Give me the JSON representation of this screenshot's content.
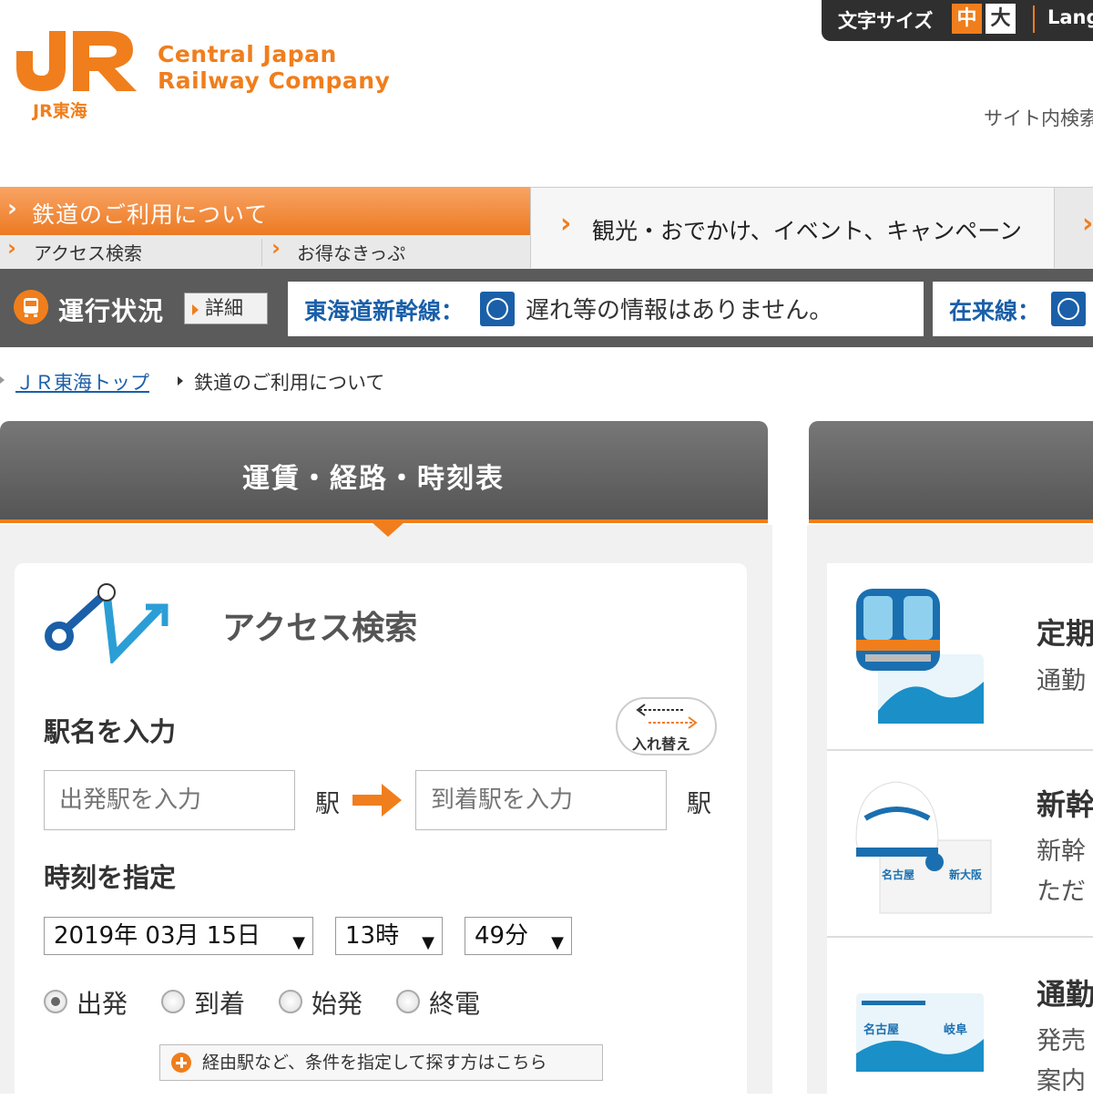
{
  "header": {
    "logo_text": "JR東海",
    "company_line1": "Central Japan",
    "company_line2": "Railway Company",
    "font_size_label": "文字サイズ",
    "font_size_medium": "中",
    "font_size_large": "大",
    "language_label": "Lang",
    "site_search_label": "サイト内検索"
  },
  "nav": {
    "main_item": "鉄道のご利用について",
    "sub_items": [
      "アクセス検索",
      "お得なきっぷ"
    ],
    "tourism_item": "観光・おでかけ、イベント、キャンペーン"
  },
  "status": {
    "title": "運行状況",
    "detail_button": "詳細",
    "shinkansen_label": "東海道新幹線：",
    "shinkansen_message": "遅れ等の情報はありません。",
    "conventional_label": "在来線："
  },
  "breadcrumb": {
    "home": "ＪＲ東海トップ",
    "current": "鉄道のご利用について"
  },
  "tabs": {
    "fare_route_timetable": "運賃・経路・時刻表"
  },
  "access_search": {
    "title": "アクセス検索",
    "station_section_label": "駅名を入力",
    "swap_button": "入れ替え",
    "departure_placeholder": "出発駅を入力",
    "arrival_placeholder": "到着駅を入力",
    "station_suffix": "駅",
    "time_section_label": "時刻を指定",
    "date_value": "2019年 03月 15日",
    "hour_value": "13時",
    "minute_value": "49分",
    "radio_options": [
      {
        "label": "出発",
        "selected": true
      },
      {
        "label": "到着",
        "selected": false
      },
      {
        "label": "始発",
        "selected": false
      },
      {
        "label": "終電",
        "selected": false
      }
    ],
    "via_button": "経由駅など、条件を指定して探す方はこちら"
  },
  "right_panel": {
    "item1_title": "定期",
    "item1_text": "通勤",
    "item2_title": "新幹",
    "item2_text1": "新幹",
    "item2_text2": "ただ",
    "item2_ticket_from": "名古屋",
    "item2_ticket_to": "新大阪",
    "item3_title": "通勤",
    "item3_text1": "発売",
    "item3_text2": "案内",
    "item3_ticket_from": "名古屋",
    "item3_ticket_to": "岐阜"
  },
  "colors": {
    "brand_orange": "#f07e1c",
    "link_blue": "#1a5fa8",
    "status_bar": "#5b5b5b"
  }
}
